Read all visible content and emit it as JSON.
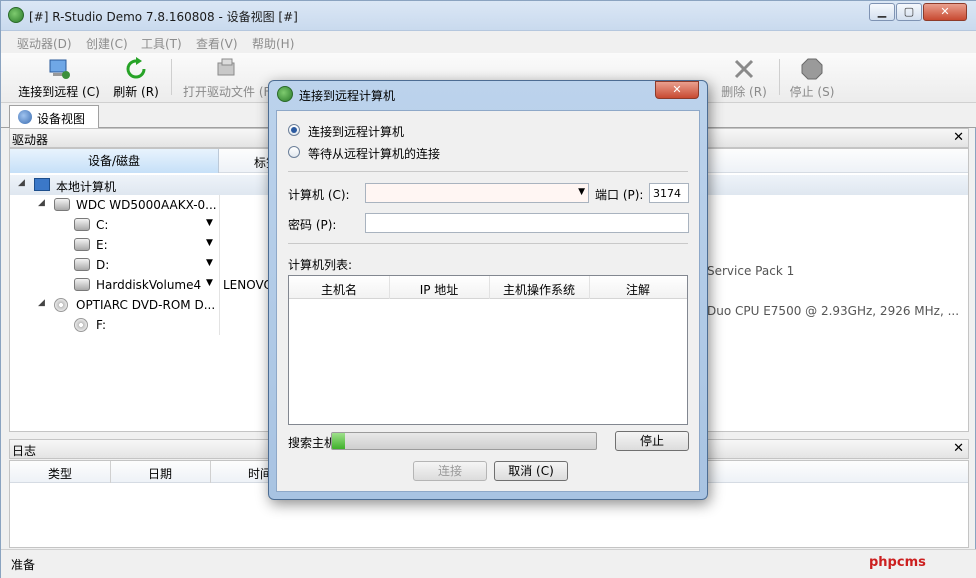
{
  "window": {
    "title": "[#] R-Studio Demo 7.8.160808 - 设备视图 [#]"
  },
  "menu": [
    "驱动器(D)",
    "创建(C)",
    "工具(T)",
    "查看(V)",
    "帮助(H)"
  ],
  "toolbar": {
    "connect_remote": "连接到远程 (C)",
    "refresh": "刷新 (R)",
    "open_drive_files": "打开驱动文件 (F)",
    "delete": "删除 (R)",
    "stop": "停止 (S)"
  },
  "tabs": {
    "device_view": "设备视图"
  },
  "drives_panel": {
    "title": "驱动器",
    "col_device": "设备/磁盘",
    "col_label": "标签",
    "rows": [
      {
        "label": "本地计算机"
      },
      {
        "label": "WDC WD5000AAKX-0..."
      },
      {
        "label": "C:"
      },
      {
        "label": "E:"
      },
      {
        "label": "D:"
      },
      {
        "label": "HarddiskVolume4",
        "extra": "LENOVO"
      },
      {
        "label": "OPTIARC DVD-ROM D..."
      },
      {
        "label": "F:"
      }
    ],
    "info_line1": "Service Pack 1",
    "info_line2": "Duo CPU     E7500  @ 2.93GHz, 2926 MHz, ..."
  },
  "log_panel": {
    "title": "日志",
    "cols": [
      "类型",
      "日期",
      "时间"
    ]
  },
  "status": {
    "text": "准备",
    "watermark": "phpcms"
  },
  "dialog": {
    "title": "连接到远程计算机",
    "radio_connect": "连接到远程计算机",
    "radio_wait": "等待从远程计算机的连接",
    "computer_label": "计算机 (C):",
    "computer_value": "",
    "port_label": "端口 (P):",
    "port_value": "3174",
    "password_label": "密码 (P):",
    "list_label": "计算机列表:",
    "list_cols": [
      "主机名",
      "IP 地址",
      "主机操作系统",
      "注解"
    ],
    "search_label": "搜索主机",
    "progress": 0.05,
    "stop_btn": "停止",
    "connect_btn": "连接",
    "cancel_btn": "取消 (C)"
  },
  "colors": {
    "accent": "#3fb02a",
    "watermark": "#cc1f1f"
  }
}
